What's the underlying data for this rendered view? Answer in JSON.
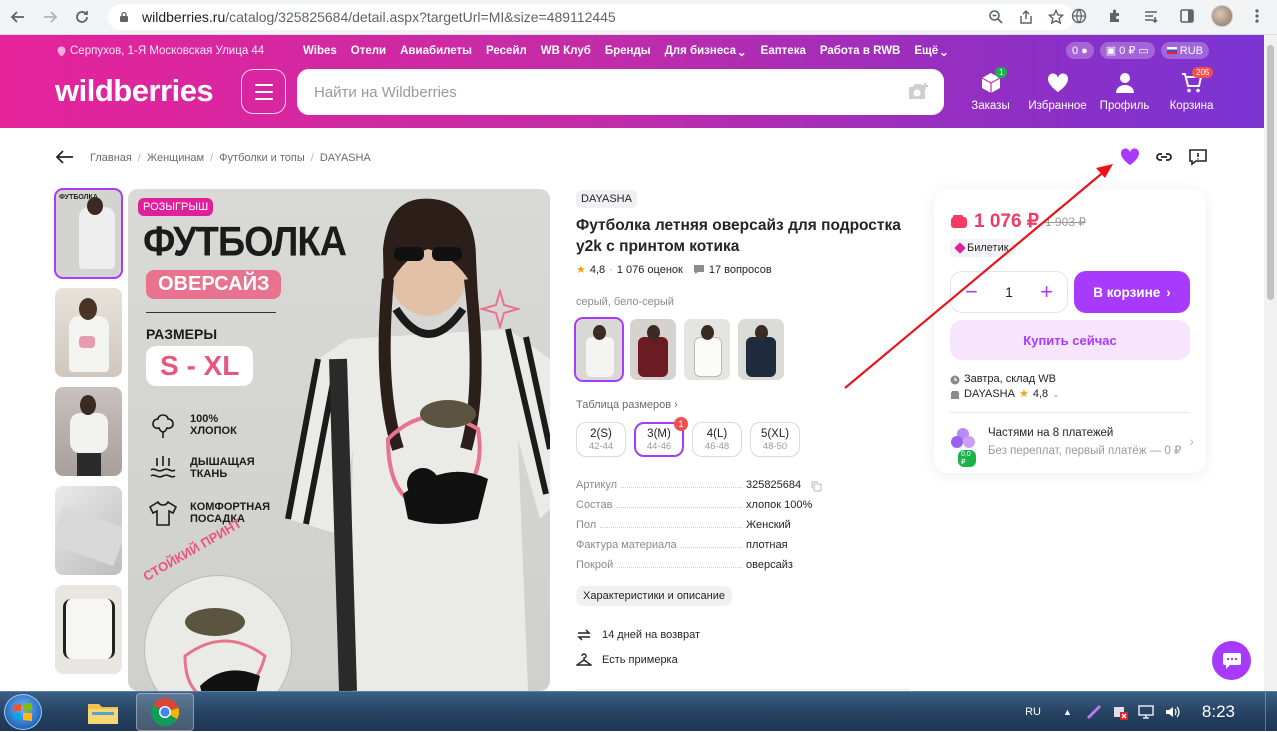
{
  "browser": {
    "url_host": "wildberries.ru",
    "url_path": "/catalog/325825684/detail.aspx?targetUrl=MI&size=489112445"
  },
  "header": {
    "location": "Серпухов, 1-Я Московская Улица 44",
    "menu": [
      "Wibes",
      "Отели",
      "Авиабилеты",
      "Ресейл",
      "WB Клуб",
      "Бренды",
      "Для бизнеса",
      "Еаптека",
      "Работа в RWB",
      "Ещё"
    ],
    "pill_points": "0",
    "pill_balance": "0 ₽",
    "currency": "RUB",
    "logo": "wildberries",
    "search_placeholder": "Найти на Wildberries",
    "icons": {
      "orders": "Заказы",
      "orders_badge": "1",
      "favorites": "Избранное",
      "profile": "Профиль",
      "cart": "Корзина",
      "cart_badge": "205"
    }
  },
  "breadcrumbs": [
    "Главная",
    "Женщинам",
    "Футболки и топы",
    "DAYASHA"
  ],
  "gallery": {
    "raffle": "РОЗЫГРЫШ",
    "promo_title": "ФУТБОЛКА",
    "promo_tag": "ОВЕРСАЙЗ",
    "sizes_label": "РАЗМЕРЫ",
    "sizes_range": "S - XL",
    "feature_1": "100%\nХЛОПОК",
    "feature_2": "ДЫШАЩАЯ\nТКАНЬ",
    "feature_3": "КОМФОРТНАЯ\nПОСАДКА",
    "stamp": "СТОЙКИЙ ПРИНТ",
    "thumb_text": "ФУТБОЛКА"
  },
  "product": {
    "brand": "DAYASHA",
    "title": "Футболка летняя оверсайз для подростка y2k с принтом котика",
    "rating": "4,8",
    "reviews": "1 076 оценок",
    "questions": "17 вопросов",
    "color": "серый, бело-серый",
    "size_table": "Таблица размеров",
    "sizes": [
      {
        "label": "2(S)",
        "range": "42-44"
      },
      {
        "label": "3(M)",
        "range": "44-46",
        "badge": "1"
      },
      {
        "label": "4(L)",
        "range": "46-48"
      },
      {
        "label": "5(XL)",
        "range": "48-50"
      }
    ],
    "specs": [
      {
        "k": "Артикул",
        "v": "325825684"
      },
      {
        "k": "Состав",
        "v": "хлопок 100%"
      },
      {
        "k": "Пол",
        "v": "Женский"
      },
      {
        "k": "Фактура материала",
        "v": "плотная"
      },
      {
        "k": "Покрой",
        "v": "оверсайз"
      }
    ],
    "chars_button": "Характеристики и описание",
    "return": "14 дней на возврат",
    "fitting": "Есть примерка"
  },
  "card": {
    "price": "1 076 ₽",
    "old_price": "1 903 ₽",
    "ticket": "Билетик",
    "qty": "1",
    "in_cart": "В корзине",
    "buy_now": "Купить сейчас",
    "delivery": "Завтра, склад WB",
    "seller": "DAYASHA",
    "seller_rating": "4,8",
    "install_title": "Частями на 8 платежей",
    "install_sub": "Без переплат, первый платёж — 0 ₽",
    "coin": "0,0 ₽"
  },
  "taskbar": {
    "lang": "RU",
    "time": "8:23"
  },
  "colors": {
    "accent": "#a73afd",
    "price": "#f13a64",
    "arrow": "#e8141a"
  }
}
